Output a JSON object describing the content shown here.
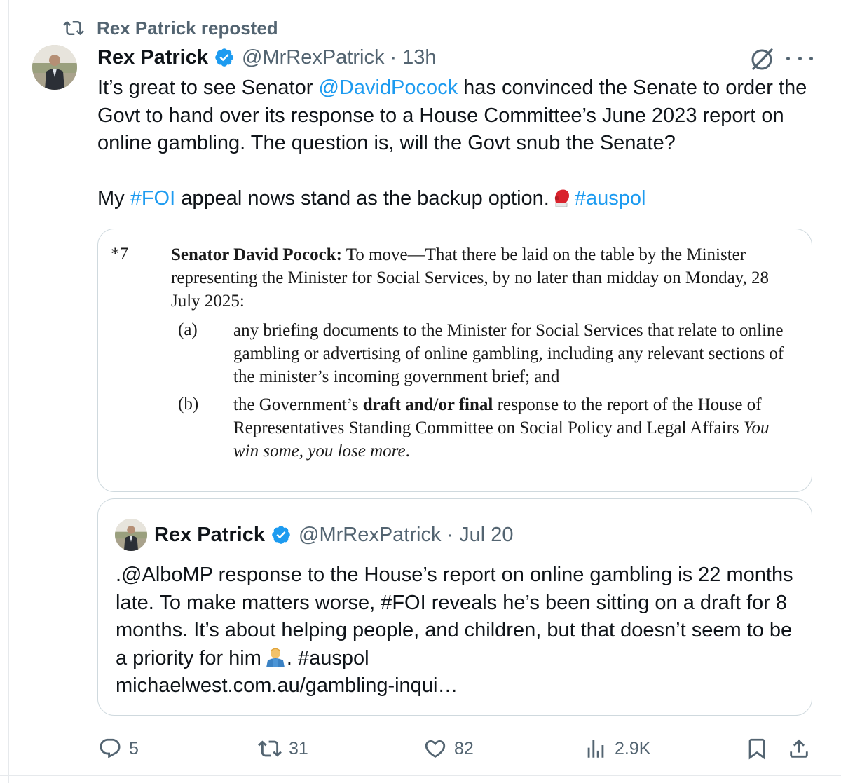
{
  "repost_banner": {
    "label": "Rex Patrick reposted"
  },
  "tweet": {
    "author_name": "Rex Patrick",
    "handle": "@MrRexPatrick",
    "separator": "·",
    "time": "13h",
    "text": {
      "p1_a": "It’s great to see Senator ",
      "p1_mention": "@DavidPocock",
      "p1_b": " has convinced the Senate to order the Govt to hand over its response to a House Committee’s June 2023 report on online gambling. The question is, will the Govt snub the Senate?",
      "p2_a": "My ",
      "p2_hashtag1": "#FOI",
      "p2_b": " appeal nows stand as the backup option.",
      "p2_hashtag2": "#auspol"
    }
  },
  "document": {
    "number": "*7",
    "mover": "Senator David Pocock:",
    "motion": " To move—That there be laid on the table by the Minister representing the Minister for Social Services, by no later than midday on Monday, 28 July 2025:",
    "item_a_label": "(a)",
    "item_a_text": "any briefing documents to the Minister for Social Services that relate to online gambling or advertising of online gambling, including any relevant sections of the minister’s incoming government brief; and",
    "item_b_label": "(b)",
    "item_b_pre": "the Government’s ",
    "item_b_bold": "draft and/or final",
    "item_b_mid": " response to the report of the House of Representatives Standing Committee on Social Policy and Legal Affairs ",
    "item_b_italic": "You win some, you lose more",
    "item_b_end": "."
  },
  "quoted_tweet": {
    "author_name": "Rex Patrick",
    "handle": "@MrRexPatrick",
    "separator": "·",
    "time": "Jul 20",
    "text_main": ".@AlboMP response to the House’s report on online gambling is 22 months late. To make matters worse, #FOI reveals he’s been sitting on a draft for 8 months. It’s about helping people, and children, but that doesn’t seem to be a priority for him",
    "text_after_emoji": ". #auspol",
    "link": "michaelwest.com.au/gambling-inqui…"
  },
  "actions": {
    "replies": "5",
    "reposts": "31",
    "likes": "82",
    "views": "2.9K"
  },
  "icons": [
    "repost-icon",
    "verified-badge-icon",
    "grok-icon",
    "more-icon",
    "boxing-glove-icon",
    "shrug-person-icon",
    "reply-icon",
    "like-icon",
    "views-icon",
    "bookmark-icon",
    "share-icon"
  ],
  "colors": {
    "link": "#1d9bf0",
    "secondary_text": "#536471",
    "verified": "#1d9bf0",
    "border": "#cfd9de"
  }
}
